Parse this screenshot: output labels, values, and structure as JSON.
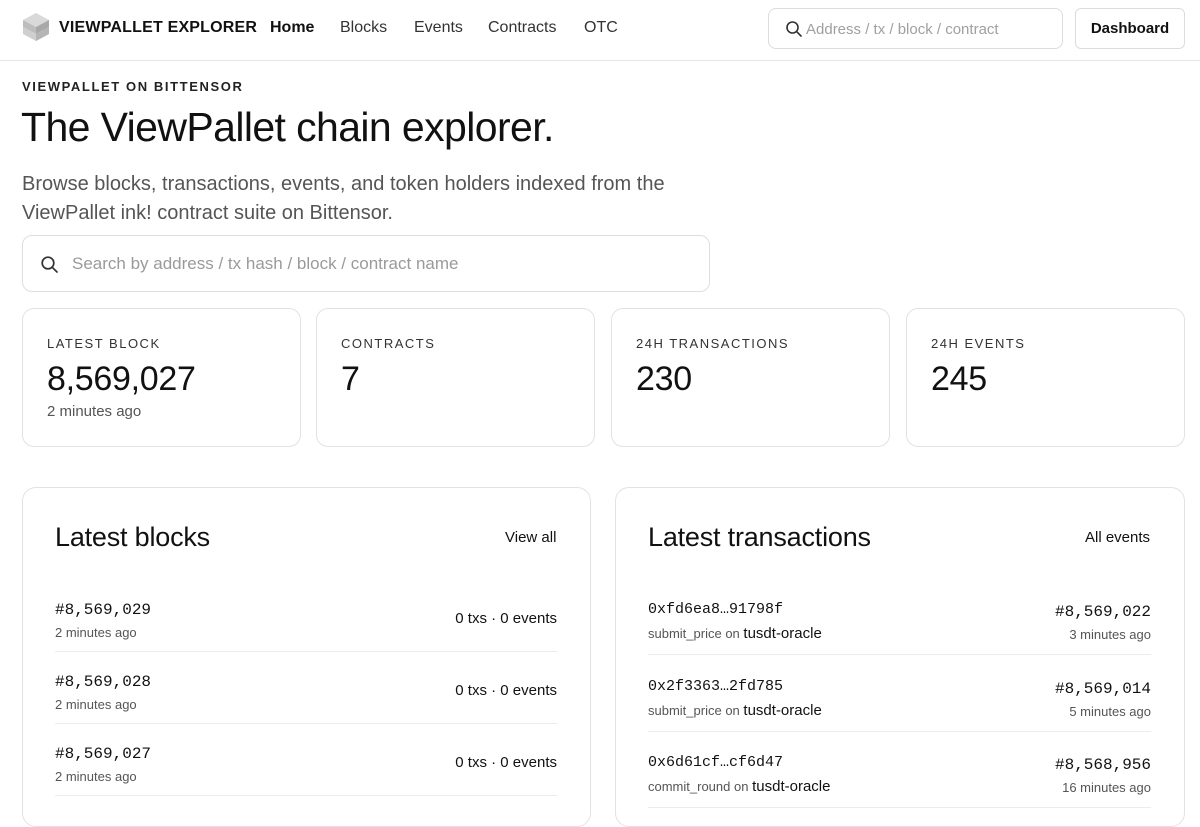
{
  "header": {
    "brand": "VIEWPALLET EXPLORER",
    "nav": [
      "Home",
      "Blocks",
      "Events",
      "Contracts",
      "OTC"
    ],
    "active_nav": "Home",
    "search_placeholder": "Address / tx / block / contract",
    "dashboard_label": "Dashboard"
  },
  "hero": {
    "eyebrow": "VIEWPALLET ON BITTENSOR",
    "title": "The ViewPallet chain explorer.",
    "subtitle": "Browse blocks, transactions, events, and token holders indexed from the ViewPallet ink! contract suite on Bittensor.",
    "search_placeholder": "Search by address / tx hash / block / contract name"
  },
  "stats": [
    {
      "label": "LATEST BLOCK",
      "value": "8,569,027",
      "sub": "2 minutes ago"
    },
    {
      "label": "CONTRACTS",
      "value": "7",
      "sub": ""
    },
    {
      "label": "24H TRANSACTIONS",
      "value": "230",
      "sub": ""
    },
    {
      "label": "24H EVENTS",
      "value": "245",
      "sub": ""
    }
  ],
  "latest_blocks": {
    "title": "Latest blocks",
    "link": "View all",
    "rows": [
      {
        "number": "#8,569,029",
        "time": "2 minutes ago",
        "counts": "0 txs · 0 events"
      },
      {
        "number": "#8,569,028",
        "time": "2 minutes ago",
        "counts": "0 txs · 0 events"
      },
      {
        "number": "#8,569,027",
        "time": "2 minutes ago",
        "counts": "0 txs · 0 events"
      }
    ]
  },
  "latest_transactions": {
    "title": "Latest transactions",
    "link": "All events",
    "on_word": "on",
    "rows": [
      {
        "hash": "0xfd6ea8…91798f",
        "method": "submit_price",
        "contract": "tusdt-oracle",
        "block": "#8,569,022",
        "time": "3 minutes ago"
      },
      {
        "hash": "0x2f3363…2fd785",
        "method": "submit_price",
        "contract": "tusdt-oracle",
        "block": "#8,569,014",
        "time": "5 minutes ago"
      },
      {
        "hash": "0x6d61cf…cf6d47",
        "method": "commit_round",
        "contract": "tusdt-oracle",
        "block": "#8,568,956",
        "time": "16 minutes ago"
      }
    ]
  },
  "icons": {
    "logo": "cube-stack-logo",
    "search": "search-icon"
  }
}
